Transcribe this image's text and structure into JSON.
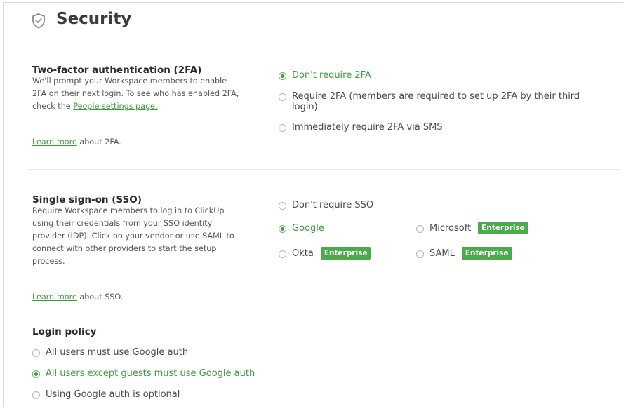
{
  "page": {
    "title": "Security",
    "title_icon": "shield-check-icon"
  },
  "two_factor": {
    "heading": "Two-factor authentication (2FA)",
    "description": "We'll prompt your Workspace members to enable 2FA on their next login. To see who has enabled 2FA, check the",
    "people_link": "People settings page.",
    "learn_more_link": "Learn more",
    "learn_more_suffix": " about 2FA.",
    "options": [
      {
        "label": "Don't require 2FA",
        "selected": true
      },
      {
        "label": "Require 2FA (members are required to set up 2FA by their third login)",
        "selected": false
      },
      {
        "label": "Immediately require 2FA via SMS",
        "selected": false
      }
    ]
  },
  "sso": {
    "heading": "Single sign-on (SSO)",
    "description": "Require Workspace members to log in to ClickUp using their credentials from your SSO identity provider (IDP). Click on your vendor or use SAML to connect with other providers to start the setup process.",
    "learn_more_link": "Learn more",
    "learn_more_suffix": " about SSO.",
    "options": [
      {
        "label": "Don't require SSO",
        "selected": false,
        "badge": ""
      },
      {
        "label": "Google",
        "selected": true,
        "badge": ""
      },
      {
        "label": "Microsoft",
        "selected": false,
        "badge": "Enterprise"
      },
      {
        "label": "Okta",
        "selected": false,
        "badge": "Enterprise"
      },
      {
        "label": "SAML",
        "selected": false,
        "badge": "Enterprise"
      }
    ]
  },
  "login_policy": {
    "heading": "Login policy",
    "options": [
      {
        "label": "All users must use Google auth",
        "selected": false
      },
      {
        "label": "All users except guests must use Google auth",
        "selected": true
      },
      {
        "label": "Using Google auth is optional",
        "selected": false
      }
    ]
  },
  "colors": {
    "accent_green": "#3e9a3e",
    "badge_green": "#4caa4c",
    "text": "#4a4a4a"
  }
}
